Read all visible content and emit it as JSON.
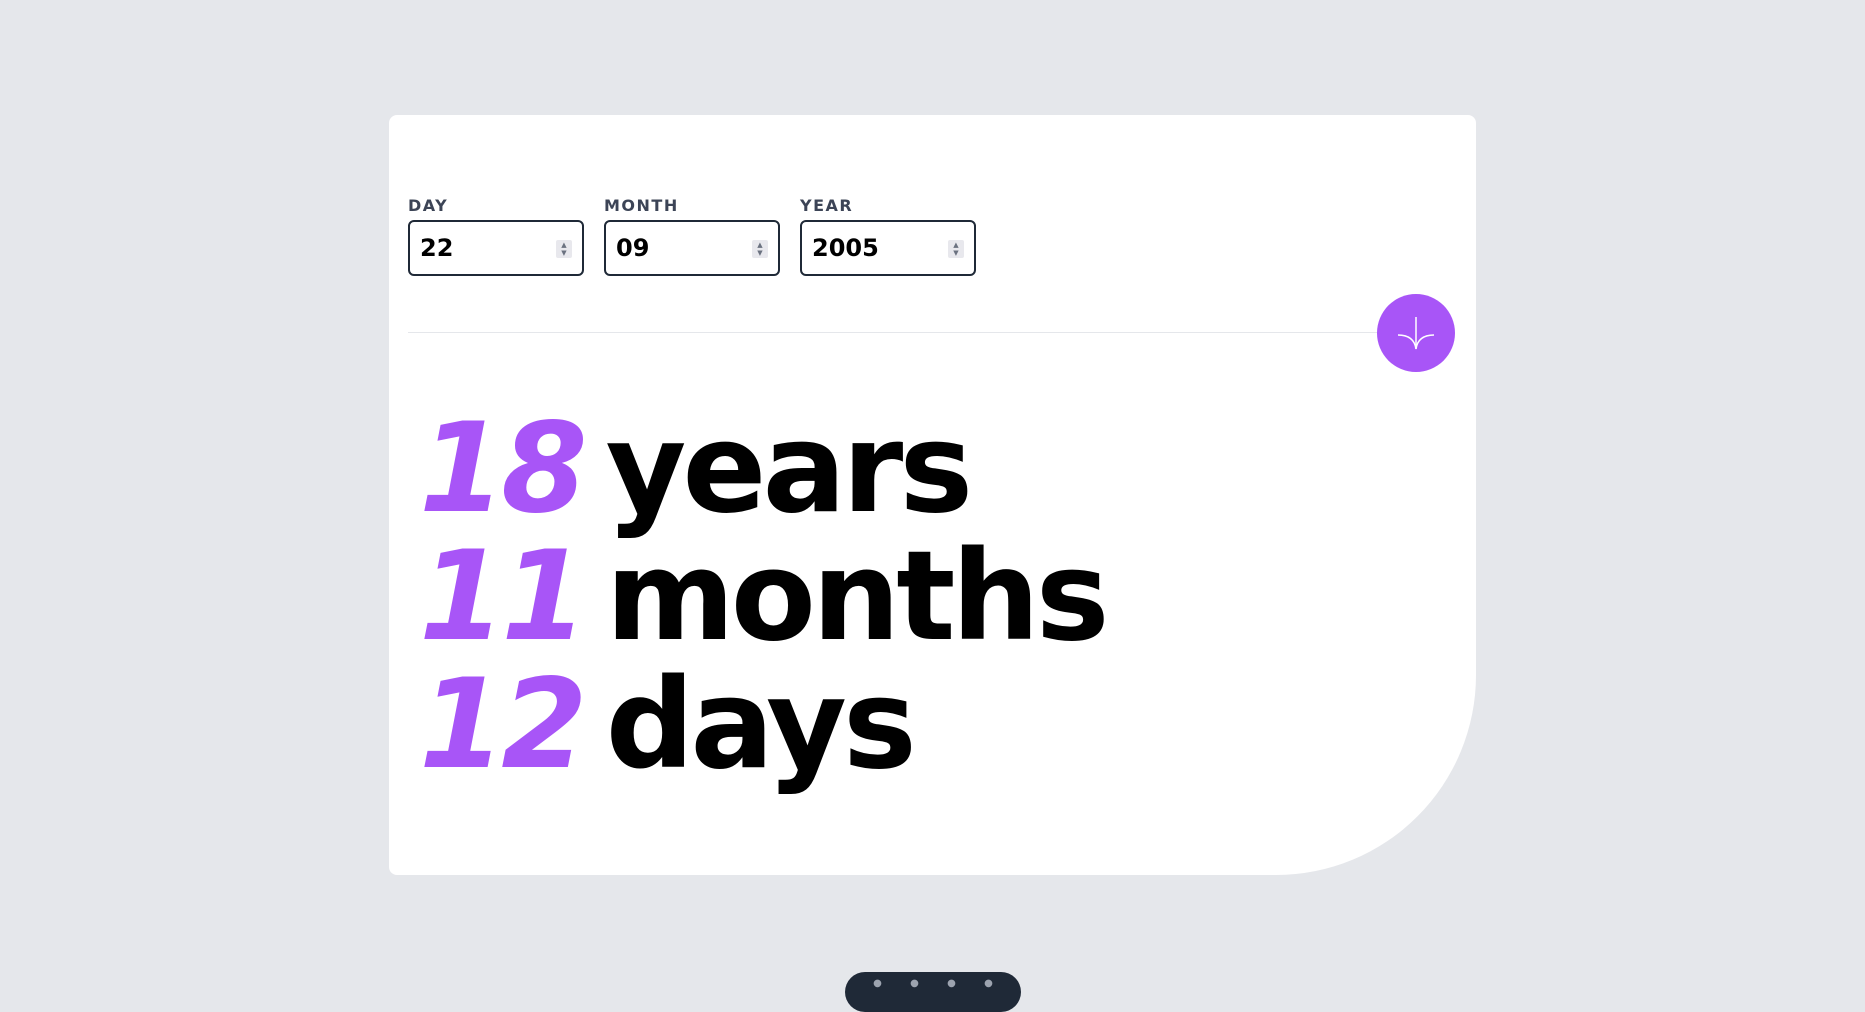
{
  "form": {
    "day": {
      "label": "DAY",
      "value": "22"
    },
    "month": {
      "label": "MONTH",
      "value": "09"
    },
    "year": {
      "label": "YEAR",
      "value": "2005"
    }
  },
  "submit": {
    "icon": "arrow-down-icon",
    "color": "#a855f7"
  },
  "results": {
    "years": {
      "value": "18",
      "unit": "years"
    },
    "months": {
      "value": "11",
      "unit": "months"
    },
    "days": {
      "value": "12",
      "unit": "days"
    }
  },
  "colors": {
    "accent": "#a855f7",
    "background": "#e5e7eb",
    "card": "#ffffff",
    "text": "#000000"
  }
}
